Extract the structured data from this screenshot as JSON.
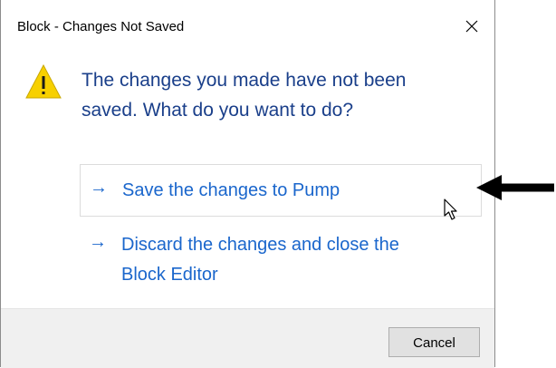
{
  "window": {
    "title": "Block - Changes Not Saved",
    "close_icon": "close-icon"
  },
  "content": {
    "warning_icon": "warning-icon",
    "instruction_line1": "The changes you made have not been",
    "instruction_line2": "saved. What do you want to do?",
    "options": [
      {
        "arrow": "→",
        "label_line1": "Save the changes to Pump",
        "label_line2": ""
      },
      {
        "arrow": "→",
        "label_line1": "Discard the changes and close the",
        "label_line2": "Block Editor"
      }
    ]
  },
  "footer": {
    "cancel_label": "Cancel"
  },
  "annotation": {
    "pointer_icon": "black-arrow-icon",
    "cursor_icon": "mouse-cursor-icon"
  },
  "colors": {
    "instruction_text": "#1a3f8a",
    "link_text": "#1a66cc",
    "footer_bg": "#f0f0f0",
    "warning_fill": "#f7d000"
  }
}
